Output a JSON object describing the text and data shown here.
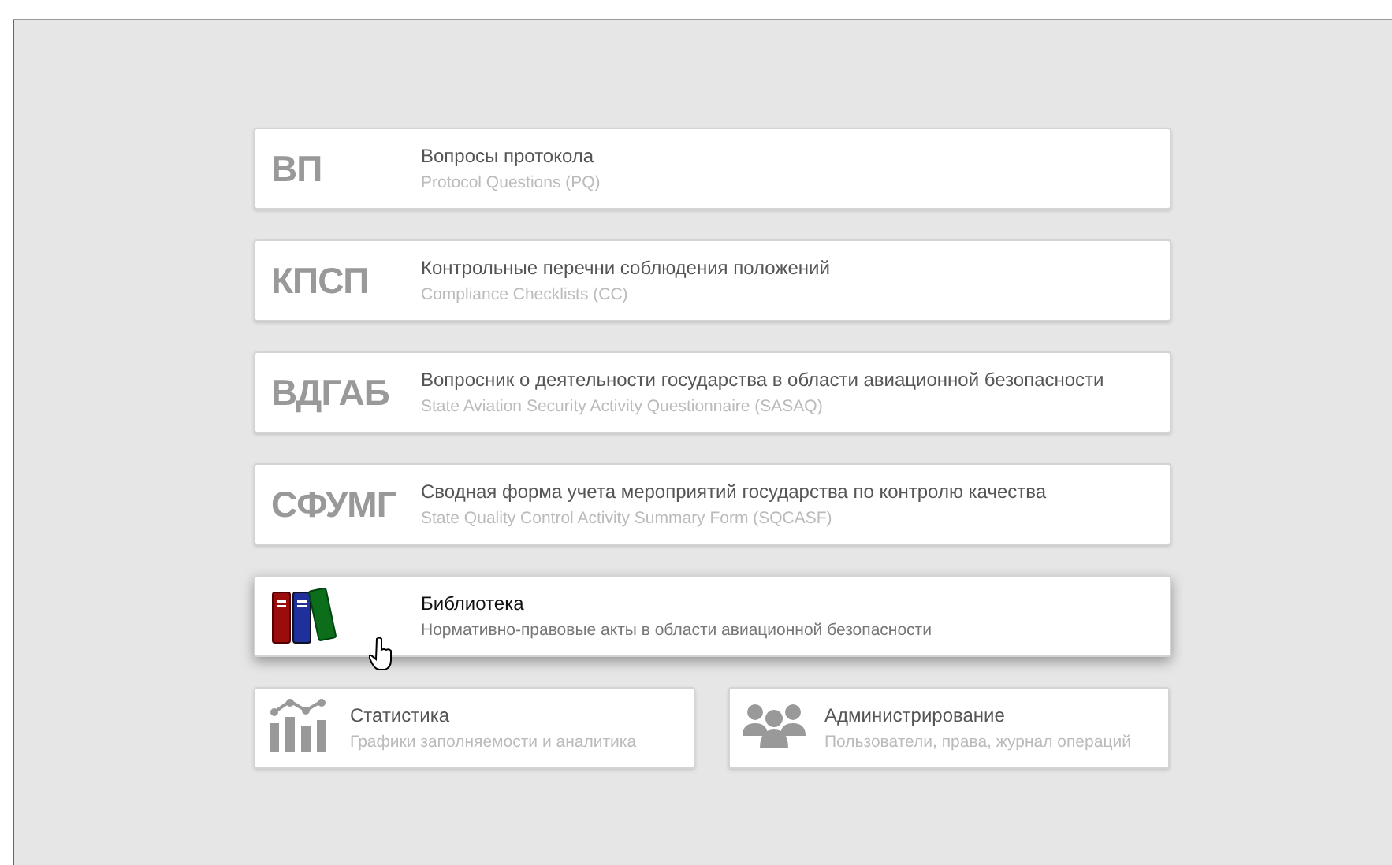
{
  "modules": [
    {
      "kind": "abbr",
      "abbr": "ВП",
      "title": "Вопросы протокола",
      "subtitle": "Protocol Questions (PQ)",
      "highlighted": false
    },
    {
      "kind": "abbr",
      "abbr": "КПСП",
      "title": "Контрольные перечни соблюдения положений",
      "subtitle": "Compliance Checklists (CC)",
      "highlighted": false
    },
    {
      "kind": "abbr",
      "abbr": "ВДГАБ",
      "title": "Вопросник о деятельности государства в области авиационной безопасности",
      "subtitle": "State Aviation Security Activity Questionnaire (SASAQ)",
      "highlighted": false
    },
    {
      "kind": "abbr",
      "abbr": "СФУМГ",
      "title": "Сводная форма учета мероприятий государства по контролю качества",
      "subtitle": "State Quality Control Activity Summary Form (SQCASF)",
      "highlighted": false
    },
    {
      "kind": "books",
      "title": "Библиотека",
      "subtitle": "Нормативно-правовые акты в области авиационной безопасности",
      "highlighted": true
    }
  ],
  "tools": [
    {
      "kind": "chart",
      "title": "Статистика",
      "subtitle": "Графики заполняемости и аналитика"
    },
    {
      "kind": "users",
      "title": "Администрирование",
      "subtitle": "Пользователи, права, журнал операций"
    }
  ]
}
